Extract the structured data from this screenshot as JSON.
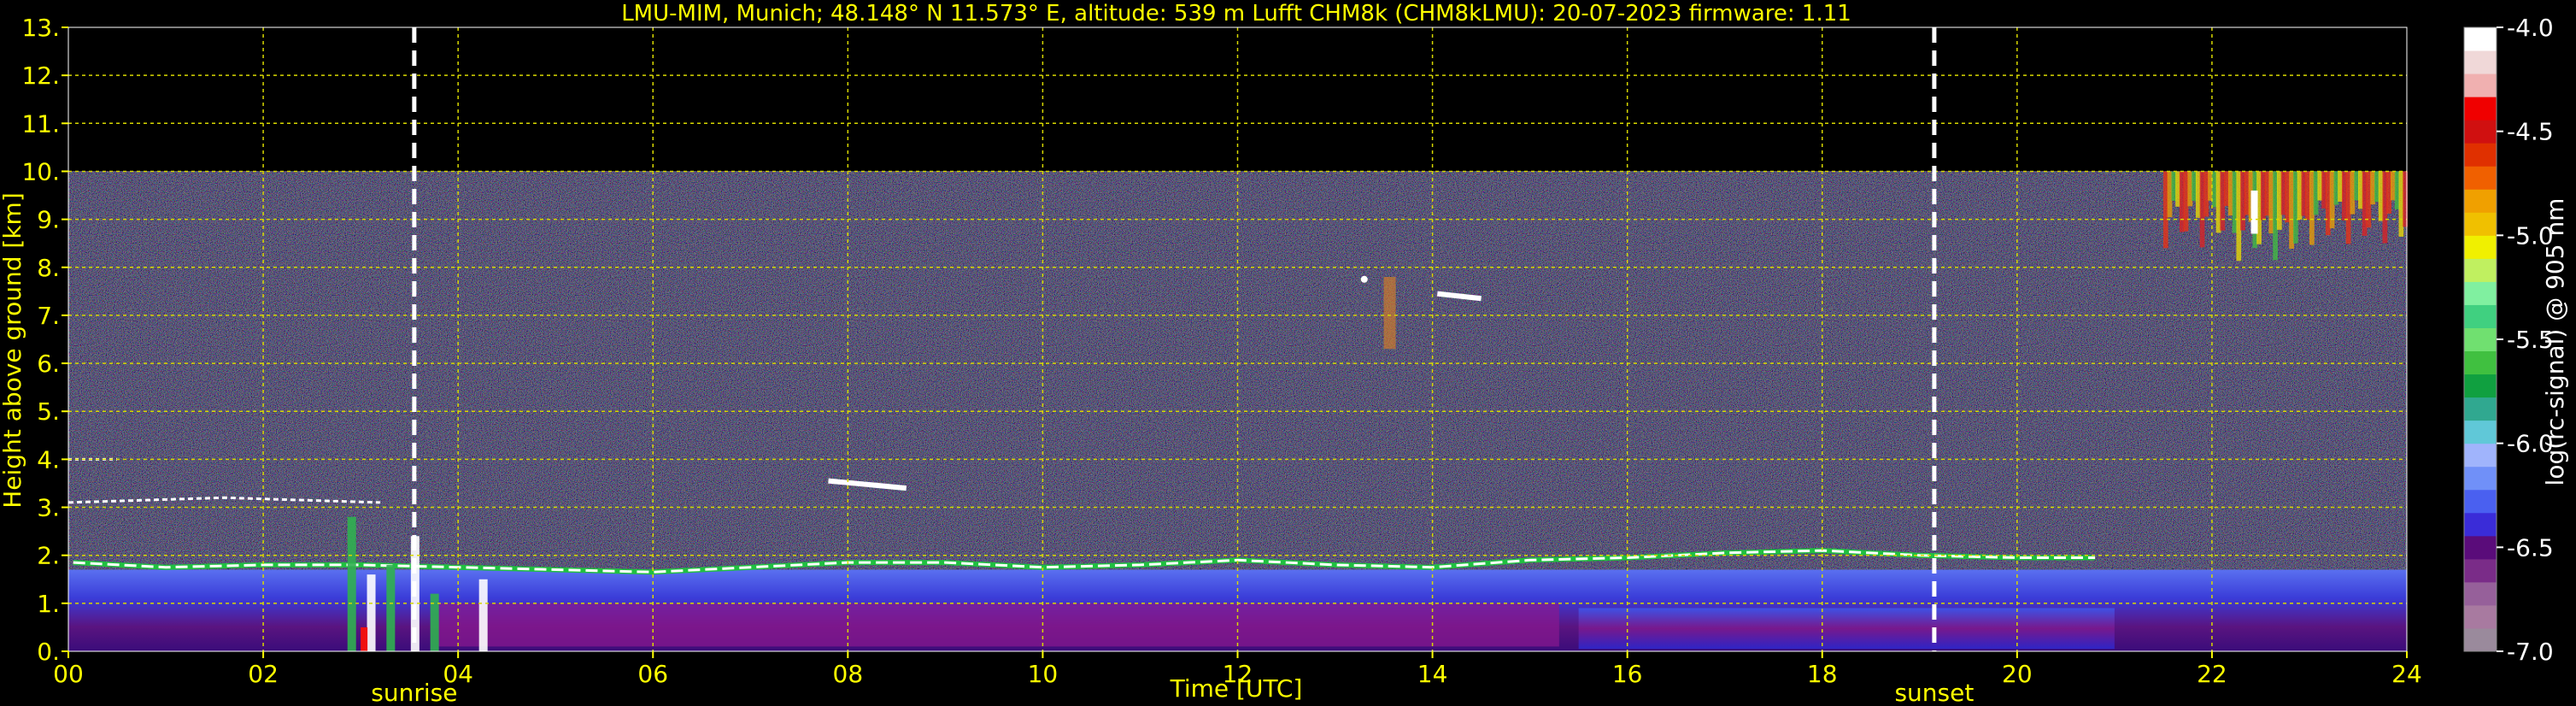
{
  "chart_data": {
    "type": "heatmap",
    "title": "LMU-MIM, Munich; 48.148° N 11.573° E, altitude: 539 m    Lufft CHM8k (CHM8kLMU): 20-07-2023    firmware: 1.11",
    "xlabel": "Time [UTC]",
    "ylabel": "Height above ground [km]",
    "xlim": [
      0,
      24
    ],
    "ylim": [
      0,
      13
    ],
    "x_ticks": [
      "00",
      "02",
      "04",
      "06",
      "08",
      "10",
      "12",
      "14",
      "16",
      "18",
      "20",
      "22",
      "24"
    ],
    "y_ticks": [
      "0.",
      "1.",
      "2.",
      "3.",
      "4.",
      "5.",
      "6.",
      "7.",
      "8.",
      "9.",
      "10.",
      "11.",
      "12.",
      "13."
    ],
    "grid": true,
    "data_ceiling_km": 10.0,
    "events": [
      {
        "label": "sunrise",
        "time": 3.55
      },
      {
        "label": "sunset",
        "time": 19.15
      }
    ],
    "colorbar": {
      "label": "log(rc-signal) @ 905 nm",
      "range": [
        -7.0,
        -4.0
      ],
      "ticks": [
        "-4.0",
        "-4.5",
        "-5.0",
        "-5.5",
        "-6.0",
        "-6.5",
        "-7.0"
      ],
      "colors": [
        "#9a8a9c",
        "#a87aa0",
        "#96609a",
        "#7a2c88",
        "#5a0c7a",
        "#3a2cd8",
        "#4a60f0",
        "#7090f8",
        "#a0b4fc",
        "#60c8d8",
        "#30a890",
        "#10a040",
        "#40c040",
        "#70e070",
        "#40d080",
        "#80f0a0",
        "#c0f060",
        "#f0f000",
        "#f0c000",
        "#f0a000",
        "#f06000",
        "#e03000",
        "#d01010",
        "#f00000",
        "#f0b0b0",
        "#f0d8d8",
        "#ffffff"
      ]
    },
    "layers": [
      {
        "name": "boundary layer",
        "top_km_range": [
          1.6,
          2.1
        ]
      },
      {
        "name": "cirrus",
        "time_range": [
          21.5,
          24
        ],
        "height_range_km": [
          8.2,
          10
        ]
      }
    ]
  }
}
